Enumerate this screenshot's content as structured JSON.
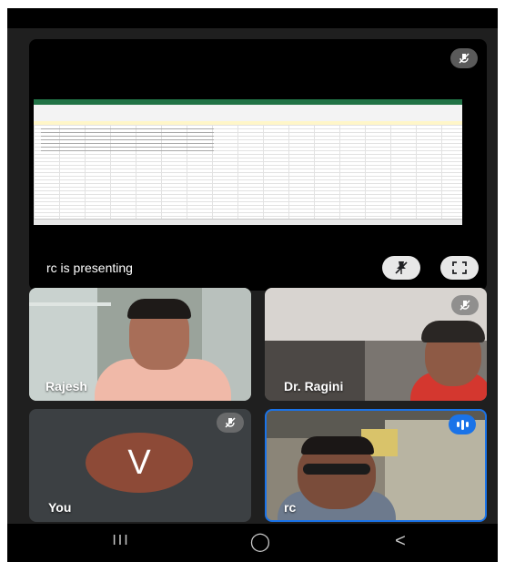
{
  "presentation": {
    "presenter_label": "rc is presenting",
    "icons": [
      "mic-off-icon",
      "unpin-icon",
      "fullscreen-icon"
    ]
  },
  "participants": [
    {
      "name": "Rajesh",
      "muted": false
    },
    {
      "name": "Dr. Ragini",
      "muted": true
    },
    {
      "name": "You",
      "avatar_letter": "V",
      "muted": true
    },
    {
      "name": "rc",
      "muted": false,
      "speaking": true
    }
  ],
  "navigation": {
    "recents_glyph": "III",
    "home_glyph": "◯",
    "back_glyph": "<"
  },
  "colors": {
    "speaking_border": "#1a73e8",
    "avatar_bg": "#8d4a37",
    "tile_bg": "#3c4043"
  }
}
